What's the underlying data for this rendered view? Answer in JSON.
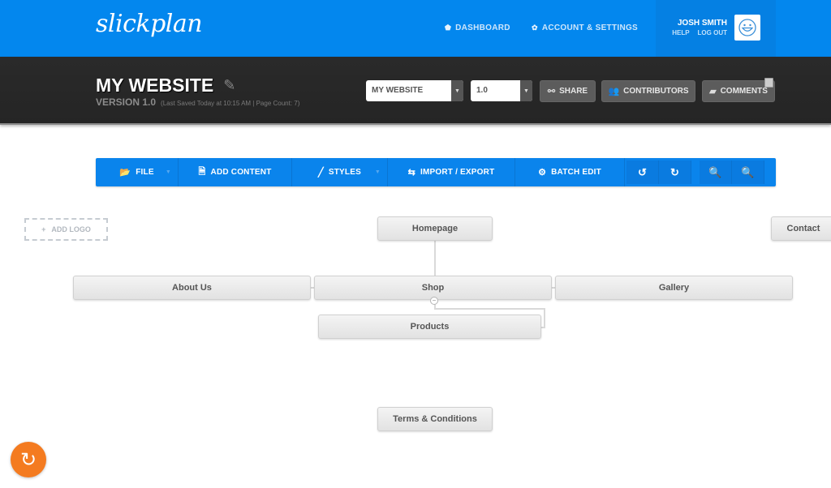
{
  "header": {
    "logo": "slickplan",
    "nav": [
      {
        "label": "DASHBOARD",
        "icon": "home-icon"
      },
      {
        "label": "ACCOUNT & SETTINGS",
        "icon": "gear-icon"
      }
    ],
    "user": {
      "name": "JOSH SMITH",
      "links": [
        "HELP",
        "LOG OUT"
      ],
      "avatar_icon": "smiley-avatar-icon"
    }
  },
  "project": {
    "title": "MY WEBSITE",
    "version_label": "VERSION 1.0",
    "meta": "(Last Saved Today at 10:15 AM  |  Page Count: 7)",
    "sitemap_select": "MY WEBSITE",
    "version_select": "1.0",
    "buttons": {
      "share": "SHARE",
      "contributors": "CONTRIBUTORS",
      "comments": "COMMENTS"
    }
  },
  "toolbar": {
    "file": "FILE",
    "add_content": "ADD CONTENT",
    "styles": "STYLES",
    "import_export": "IMPORT / EXPORT",
    "batch_edit": "BATCH EDIT"
  },
  "canvas": {
    "add_logo": "ADD LOGO",
    "pages": {
      "homepage": "Homepage",
      "contact": "Contact",
      "about": "About Us",
      "shop": "Shop",
      "gallery": "Gallery",
      "products": "Products",
      "terms": "Terms & Conditions"
    }
  },
  "colors": {
    "brand_blue": "#0387ee",
    "dark_bar": "#262626",
    "refresh_orange": "#f47b20"
  }
}
